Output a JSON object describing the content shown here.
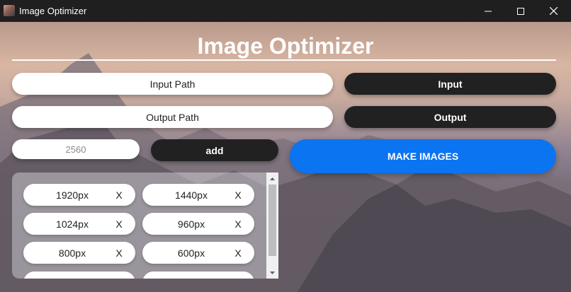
{
  "window": {
    "title": "Image Optimizer",
    "icons": {
      "minimize": "minimize-icon",
      "maximize": "maximize-icon",
      "close": "close-icon"
    }
  },
  "main": {
    "heading": "Image Optimizer",
    "input_path_label": "Input Path",
    "input_button": "Input",
    "output_path_label": "Output Path",
    "output_button": "Output",
    "size_field_value": "2560",
    "add_button": "add",
    "make_button": "MAKE IMAGES"
  },
  "sizes": [
    {
      "label": "1920px",
      "remove": "X"
    },
    {
      "label": "1440px",
      "remove": "X"
    },
    {
      "label": "1024px",
      "remove": "X"
    },
    {
      "label": "960px",
      "remove": "X"
    },
    {
      "label": "800px",
      "remove": "X"
    },
    {
      "label": "600px",
      "remove": "X"
    }
  ],
  "colors": {
    "accent": "#0b74f0",
    "dark_button": "#212121",
    "titlebar": "#1f1f1f"
  }
}
